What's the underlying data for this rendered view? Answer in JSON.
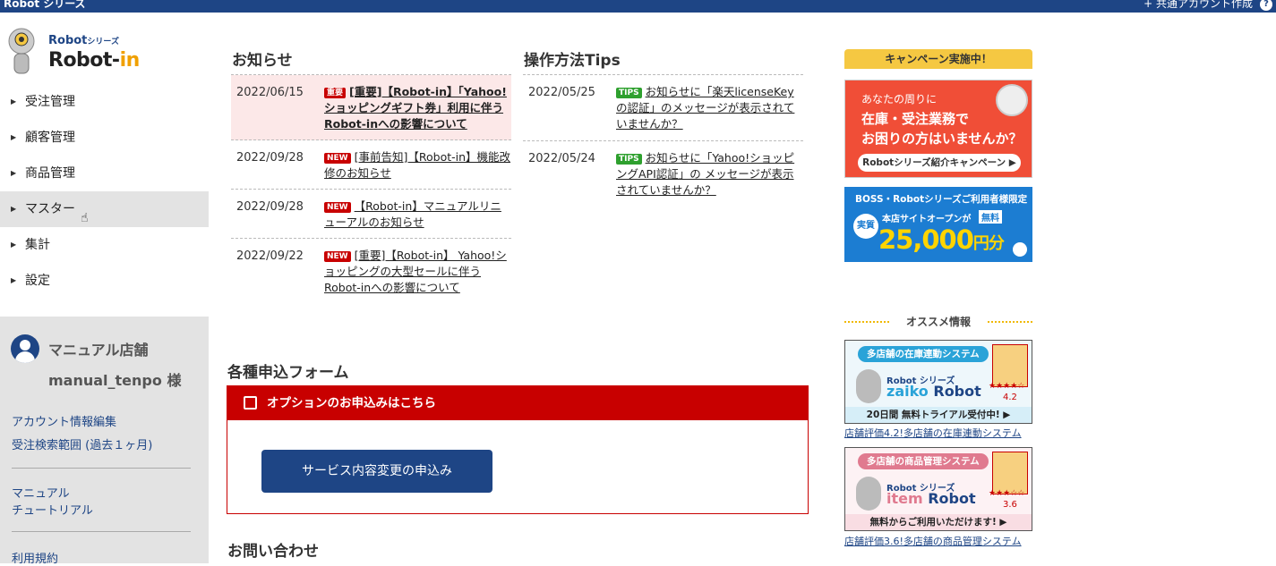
{
  "topbar": {
    "brand": "Robot シリーズ",
    "account": "+ 共通アカウント作成",
    "help": "?"
  },
  "logo": {
    "series": "Robot",
    "series_small": "シリーズ",
    "name_main": "Robot-",
    "name_accent": "in"
  },
  "nav": [
    "受注管理",
    "顧客管理",
    "商品管理",
    "マスター",
    "集計",
    "設定"
  ],
  "user": {
    "shop": "マニュアル店舗",
    "login": "manual_tenpo 様",
    "links": [
      "アカウント情報編集",
      "受注検索範囲 (過去１ヶ月)",
      "マニュアル",
      "チュートリアル",
      "利用規約"
    ]
  },
  "news": {
    "title": "お知らせ",
    "items": [
      {
        "date": "2022/06/15",
        "badge": "重要",
        "text": "[重要]【Robot-in】「Yahoo!ショッピングギフト券」利用に伴うRobot-inへの影響について"
      },
      {
        "date": "2022/09/28",
        "badge": "NEW",
        "text": "[事前告知]【Robot-in】機能改修のお知らせ"
      },
      {
        "date": "2022/09/28",
        "badge": "NEW",
        "text": "【Robot-in】マニュアルリニューアルのお知らせ"
      },
      {
        "date": "2022/09/22",
        "badge": "NEW",
        "text": "[重要]【Robot-in】 Yahoo!ショッピングの大型セールに伴うRobot-inへの影響について"
      }
    ]
  },
  "tips": {
    "title": "操作方法Tips",
    "items": [
      {
        "date": "2022/05/25",
        "badge": "TIPS",
        "text": "お知らせに「楽天licenseKeyの認証」のメッセージが表示されていませんか？"
      },
      {
        "date": "2022/05/24",
        "badge": "TIPS",
        "text": "お知らせに「Yahoo!ショッピングAPI認証」の メッセージが表示されていませんか？"
      }
    ]
  },
  "forms": {
    "title": "各種申込フォーム",
    "header": "オプションのお申込みはこちら",
    "button": "サービス内容変更の申込み"
  },
  "contact": {
    "title": "お問い合わせ"
  },
  "campaign": {
    "tag": "キャンペーン実施中！",
    "b1_line1": "あなたの周りに",
    "b1_line2": "在庫・受注業務で",
    "b1_line3": "お困りの方はいませんか？",
    "b1_cta": "Robotシリーズ紹介キャンペーン ▶",
    "b2_line1": "BOSS・Robotシリーズご利用者様限定",
    "b2_line2": "本店サイトオープンが",
    "b2_free": "無料",
    "b2_real": "実質",
    "b2_amount": "25,000",
    "b2_unit": "円分"
  },
  "recommend": {
    "title": "オススメ情報",
    "products": [
      {
        "tag": "多店舗の在庫連動システム",
        "series": "Robot シリーズ",
        "name_a": "zaiko",
        "name_b": " Robot",
        "stars": "★★★★☆",
        "score": "4.2",
        "foot": "20日間 無料トライアル受付中! ▶",
        "link": "店舗評価4.2!多店舗の在庫連動システム"
      },
      {
        "tag": "多店舗の商品管理システム",
        "series": "Robot シリーズ",
        "name_a": "item",
        "name_b": " Robot",
        "stars": "★★★☆☆",
        "score": "3.6",
        "foot": "無料からご利用いただけます! ▶",
        "link": "店舗評価3.6!多店舗の商品管理システム"
      }
    ]
  },
  "colors": {
    "primary": "#1e4585",
    "accent_red": "#c80000",
    "highlight": "#fce8e8"
  }
}
